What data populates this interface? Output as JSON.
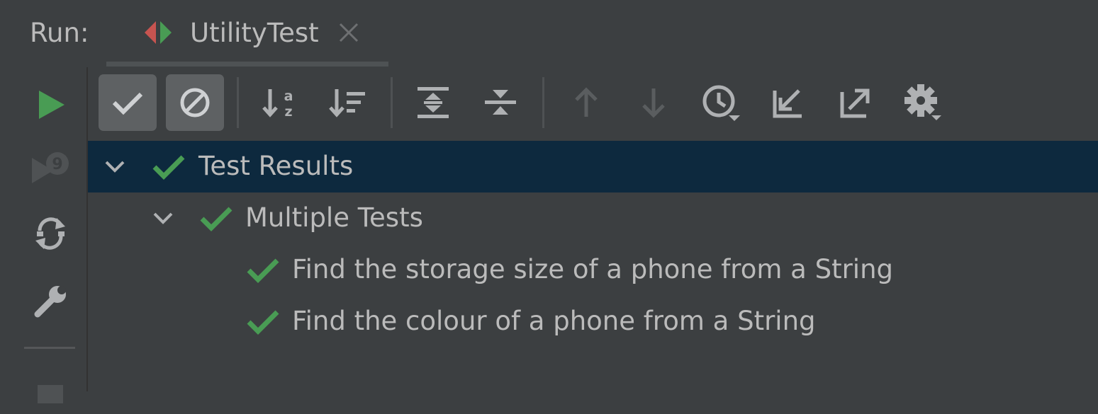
{
  "header": {
    "run_label": "Run:",
    "tab": {
      "title": "UtilityTest",
      "icon": "test-run-icon",
      "close_icon": "close-icon"
    }
  },
  "left_toolbar": {
    "items": [
      {
        "icon": "rerun-icon",
        "state": "enabled"
      },
      {
        "icon": "rerun-failed-tests-icon",
        "state": "disabled"
      },
      {
        "icon": "toggle-auto-test-icon",
        "state": "enabled"
      },
      {
        "icon": "wrench-icon",
        "state": "enabled"
      },
      {
        "icon": "stop-icon",
        "state": "disabled"
      }
    ]
  },
  "test_toolbar": {
    "items": [
      {
        "icon": "show-passed-icon",
        "pressed": true
      },
      {
        "icon": "show-ignored-icon",
        "pressed": true
      },
      {
        "icon": "sort-alphabetically-icon",
        "pressed": false
      },
      {
        "icon": "sort-by-duration-icon",
        "pressed": false
      },
      {
        "icon": "expand-all-icon",
        "pressed": false
      },
      {
        "icon": "collapse-all-icon",
        "pressed": false
      },
      {
        "icon": "previous-occurrence-icon",
        "state": "disabled"
      },
      {
        "icon": "next-occurrence-icon",
        "state": "disabled"
      },
      {
        "icon": "test-history-icon",
        "pressed": false
      },
      {
        "icon": "import-tests-icon",
        "pressed": false
      },
      {
        "icon": "export-tests-icon",
        "pressed": false
      },
      {
        "icon": "gear-icon",
        "pressed": false
      }
    ]
  },
  "tree": {
    "rows": [
      {
        "label": "Test Results",
        "status": "passed",
        "expanded": true,
        "selected": true
      },
      {
        "label": "Multiple Tests",
        "status": "passed",
        "expanded": true,
        "selected": false
      },
      {
        "label": "Find the storage size of a phone from a String",
        "status": "passed",
        "selected": false
      },
      {
        "label": "Find the colour of a phone from a String",
        "status": "passed",
        "selected": false
      }
    ]
  },
  "colors": {
    "background": "#3c3f41",
    "selection": "#0d293e",
    "pressed_button": "#5e6163",
    "pass_green": "#499c54",
    "text": "#bbbbbb",
    "icon": "#afb1b3",
    "disabled_icon": "#5a5d5f"
  }
}
